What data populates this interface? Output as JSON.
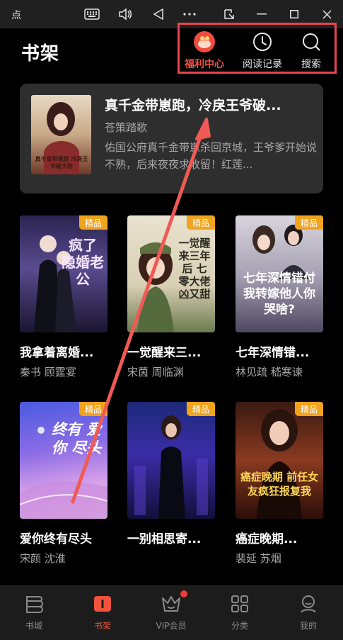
{
  "window": {
    "app_title": "点",
    "controls": [
      "keyboard-icon",
      "volume-icon",
      "back-triangle-icon",
      "more-icon",
      "pop-out-icon",
      "minimize-icon",
      "maximize-icon",
      "close-icon"
    ]
  },
  "header": {
    "title": "书架",
    "actions": [
      {
        "label": "福利中心",
        "icon": "gift-icon",
        "active": true
      },
      {
        "label": "阅读记录",
        "icon": "clock-icon",
        "active": false
      },
      {
        "label": "搜索",
        "icon": "search-icon",
        "active": false
      }
    ]
  },
  "featured": {
    "title": "真千金带崽跑，冷戾王爷破...",
    "author": "苍策踏歌",
    "description": "佑国公府真千金带崽杀回京城，王爷爹开始说不熟，后来夜夜求收留！红莲...",
    "cover_text": "真千金带崽跑 冷戾王爷破大防"
  },
  "books": [
    {
      "title": "我拿着离婚...",
      "author": "秦书  顾霆宴",
      "badge": "精品",
      "cover_text": "疯了 隐婚老公"
    },
    {
      "title": "一觉醒来三...",
      "author": "宋茵  周临渊",
      "badge": "精品",
      "cover_text": "一觉醒来三年后 七零大佬凶又甜"
    },
    {
      "title": "七年深情错...",
      "author": "林见疏  嵇寒谏",
      "badge": "精品",
      "cover_text": "七年深情错付 我转嫁他人你哭啥?"
    },
    {
      "title": "爱你终有尽头",
      "author": "宋颜  沈淮",
      "badge": "精品",
      "cover_text": "终有 爱你 尽头"
    },
    {
      "title": "一别相思寄...",
      "author": "",
      "badge": "精品",
      "cover_text": ""
    },
    {
      "title": "癌症晚期...",
      "author": "裴延  苏烟",
      "badge": "精品",
      "cover_text": "癌症晚期 前任女友疯狂报复我"
    }
  ],
  "bottom_nav": [
    {
      "label": "书城",
      "icon": "bookstore-icon",
      "active": false
    },
    {
      "label": "书架",
      "icon": "bookshelf-icon",
      "active": true
    },
    {
      "label": "VIP会员",
      "icon": "crown-icon",
      "active": false,
      "dot": true
    },
    {
      "label": "分类",
      "icon": "grid-icon",
      "active": false
    },
    {
      "label": "我的",
      "icon": "profile-icon",
      "active": false
    }
  ],
  "colors": {
    "accent": "#f0523d",
    "highlight_box": "#e8434f",
    "badge": "#f0a31c",
    "background": "#000000"
  }
}
